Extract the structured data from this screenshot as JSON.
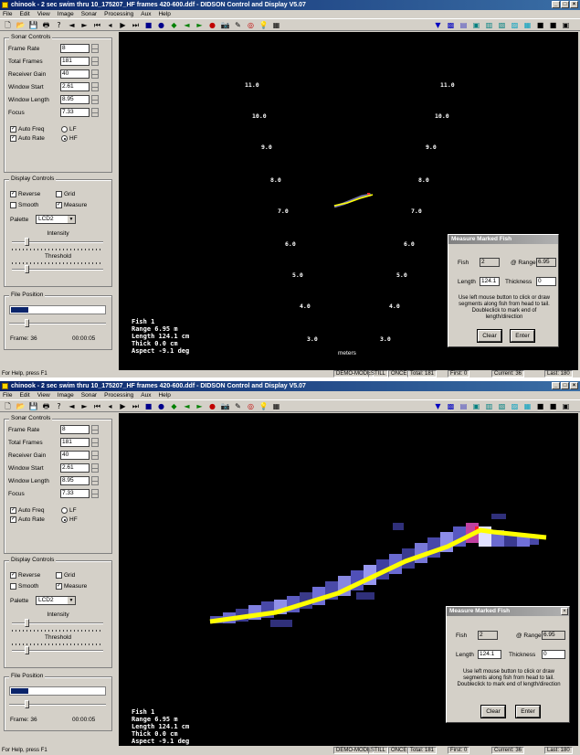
{
  "top": {
    "title": "chinook - 2 sec swim thru 10_175207_HF frames 420-600.ddf - DIDSON Control and Display  V5.07",
    "menu": [
      "File",
      "Edit",
      "View",
      "Image",
      "Sonar",
      "Processing",
      "Aux",
      "Help"
    ],
    "sonar_controls": {
      "title": "Sonar Controls",
      "fields": [
        {
          "label": "Frame Rate",
          "value": "8"
        },
        {
          "label": "Total Frames",
          "value": "181"
        },
        {
          "label": "Receiver Gain",
          "value": "40"
        },
        {
          "label": "Window Start",
          "value": "2.61"
        },
        {
          "label": "Window Length",
          "value": "8.95"
        },
        {
          "label": "Focus",
          "value": "7.33"
        }
      ],
      "auto_freq": "Auto Freq",
      "lf": "LF",
      "auto_rate": "Auto Rate",
      "hf": "HF"
    },
    "display_controls": {
      "title": "Display Controls",
      "reverse": "Reverse",
      "grid": "Grid",
      "smooth": "Smooth",
      "measure": "Measure",
      "palette_label": "Palette",
      "palette_value": "LCD2",
      "intensity": "Intensity",
      "threshold": "Threshold"
    },
    "file_position": {
      "title": "File Position",
      "progress": 0.18,
      "frame_label": "Frame: 36",
      "time": "00:00:05"
    },
    "range_labels": [
      {
        "t": "11.0"
      },
      {
        "t": "11.0"
      },
      {
        "t": "10.0"
      },
      {
        "t": "10.0"
      },
      {
        "t": "9.0"
      },
      {
        "t": "9.0"
      },
      {
        "t": "8.0"
      },
      {
        "t": "8.0"
      },
      {
        "t": "7.0"
      },
      {
        "t": "7.0"
      },
      {
        "t": "6.0"
      },
      {
        "t": "6.0"
      },
      {
        "t": "5.0"
      },
      {
        "t": "5.0"
      },
      {
        "t": "4.0"
      },
      {
        "t": "4.0"
      },
      {
        "t": "3.0"
      },
      {
        "t": "3.0"
      }
    ],
    "meters": "meters",
    "overlay": {
      "fish": "Fish     1",
      "range": "Range  6.95 m",
      "length": "Length  124.1 cm",
      "thick": "Thick   0.0 cm",
      "aspect": "Aspect -9.1 deg"
    },
    "dialog": {
      "title": "Measure Marked Fish",
      "fish_label": "Fish",
      "fish_value": "2",
      "range_label": "@ Range",
      "range_value": "6.95",
      "length_label": "Length",
      "length_value": "124.1",
      "thick_label": "Thickness",
      "thick_value": "0",
      "help": "Use left mouse button to click or draw segments along fish from head to tail.  Doubleclick to mark end of length/direction",
      "clear": "Clear",
      "enter": "Enter"
    },
    "status": {
      "help": "For Help, press F1",
      "mode": "DEMO-MODE",
      "still": "STILL",
      "once": "ONCE",
      "total": "Total: 181",
      "first": "First: 0",
      "current": "Current: 36",
      "last": "Last: 180"
    }
  },
  "bottom": {
    "title": "chinook - 2 sec swim thru 10_175207_HF frames 420-600.ddf - DIDSON Control and Display  V5.07",
    "menu": [
      "File",
      "Edit",
      "View",
      "Image",
      "Sonar",
      "Processing",
      "Aux",
      "Help"
    ],
    "sonar_controls": {
      "title": "Sonar Controls",
      "fields": [
        {
          "label": "Frame Rate",
          "value": "8"
        },
        {
          "label": "Total Frames",
          "value": "181"
        },
        {
          "label": "Receiver Gain",
          "value": "40"
        },
        {
          "label": "Window Start",
          "value": "2.61"
        },
        {
          "label": "Window Length",
          "value": "8.95"
        },
        {
          "label": "Focus",
          "value": "7.33"
        }
      ],
      "auto_freq": "Auto Freq",
      "lf": "LF",
      "auto_rate": "Auto Rate",
      "hf": "HF"
    },
    "display_controls": {
      "title": "Display Controls",
      "reverse": "Reverse",
      "grid": "Grid",
      "smooth": "Smooth",
      "measure": "Measure",
      "palette_label": "Palette",
      "palette_value": "LCD2",
      "intensity": "Intensity",
      "threshold": "Threshold"
    },
    "file_position": {
      "title": "File Position",
      "progress": 0.18,
      "frame_label": "Frame: 36",
      "time": "00:00:05"
    },
    "overlay": {
      "fish": "Fish     1",
      "range": "Range  6.95 m",
      "length": "Length  124.1 cm",
      "thick": "Thick   0.0 cm",
      "aspect": "Aspect -9.1 deg"
    },
    "dialog": {
      "title": "Measure Marked Fish",
      "fish_label": "Fish",
      "fish_value": "2",
      "range_label": "@ Range",
      "range_value": "6.95",
      "length_label": "Length",
      "length_value": "124.1",
      "thick_label": "Thickness",
      "thick_value": "0",
      "help": "Use left mouse button to click or draw segments along fish from head to tail.  Doubleclick to mark end of length/direction",
      "clear": "Clear",
      "enter": "Enter"
    },
    "status": {
      "help": "For Help, press F1",
      "mode": "DEMO-MODE",
      "still": "STILL",
      "once": "ONCE",
      "total": "Total: 181",
      "first": "First: 0",
      "current": "Current: 36",
      "last": "Last: 180"
    }
  },
  "icons": {
    "new": "new-file-icon",
    "open": "open-folder-icon",
    "save": "save-icon",
    "print": "print-icon",
    "help": "help-icon"
  },
  "colors": {
    "title_active": "#0a246a",
    "sonar_bg": "#000000",
    "trace": "#ffff00",
    "echo_low": "#4040a0",
    "echo_high": "#ff2020"
  }
}
